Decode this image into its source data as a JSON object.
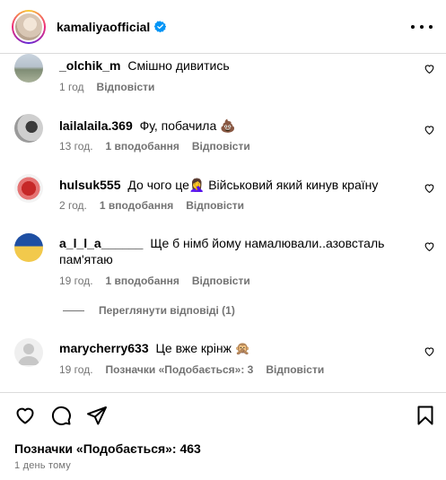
{
  "header": {
    "username": "kamaliyaofficial",
    "verified": true,
    "more_icon": "ellipsis-horizontal-icon"
  },
  "comments": [
    {
      "user": "_olchik_m",
      "text": "Смішно дивитись",
      "time": "1 год",
      "likes": "",
      "reply": "Відповісти",
      "liked": false
    },
    {
      "user": "lailalaila.369",
      "text": "Фу, побачила 💩",
      "time": "13 год.",
      "likes": "1 вподобання",
      "reply": "Відповісти",
      "liked": false
    },
    {
      "user": "hulsuk555",
      "text": "До чого це🤦‍♀️ Військовий який кинув країну",
      "time": "2 год.",
      "likes": "1 вподобання",
      "reply": "Відповісти",
      "liked": false
    },
    {
      "user": "a_l_l_a______",
      "text": "Ще б німб йому намалювали..азовсталь пам'ятаю",
      "time": "19 год.",
      "likes": "1 вподобання",
      "reply": "Відповісти",
      "liked": false
    },
    {
      "user": "marycherry633",
      "text": "Це вже крінж 🙊",
      "time": "19 год.",
      "likes": "Позначки «Подобається»: 3",
      "reply": "Відповісти",
      "liked": false
    }
  ],
  "view_replies": "Переглянути відповіді (1)",
  "footer": {
    "likes_text": "Позначки «Подобається»: 463",
    "posted_time": "1 день тому",
    "icons": [
      "heart-icon",
      "comment-icon",
      "share-icon",
      "bookmark-icon"
    ]
  },
  "colors": {
    "verified": "#0095f6",
    "meta": "#737373",
    "divider": "#dbdbdb"
  }
}
